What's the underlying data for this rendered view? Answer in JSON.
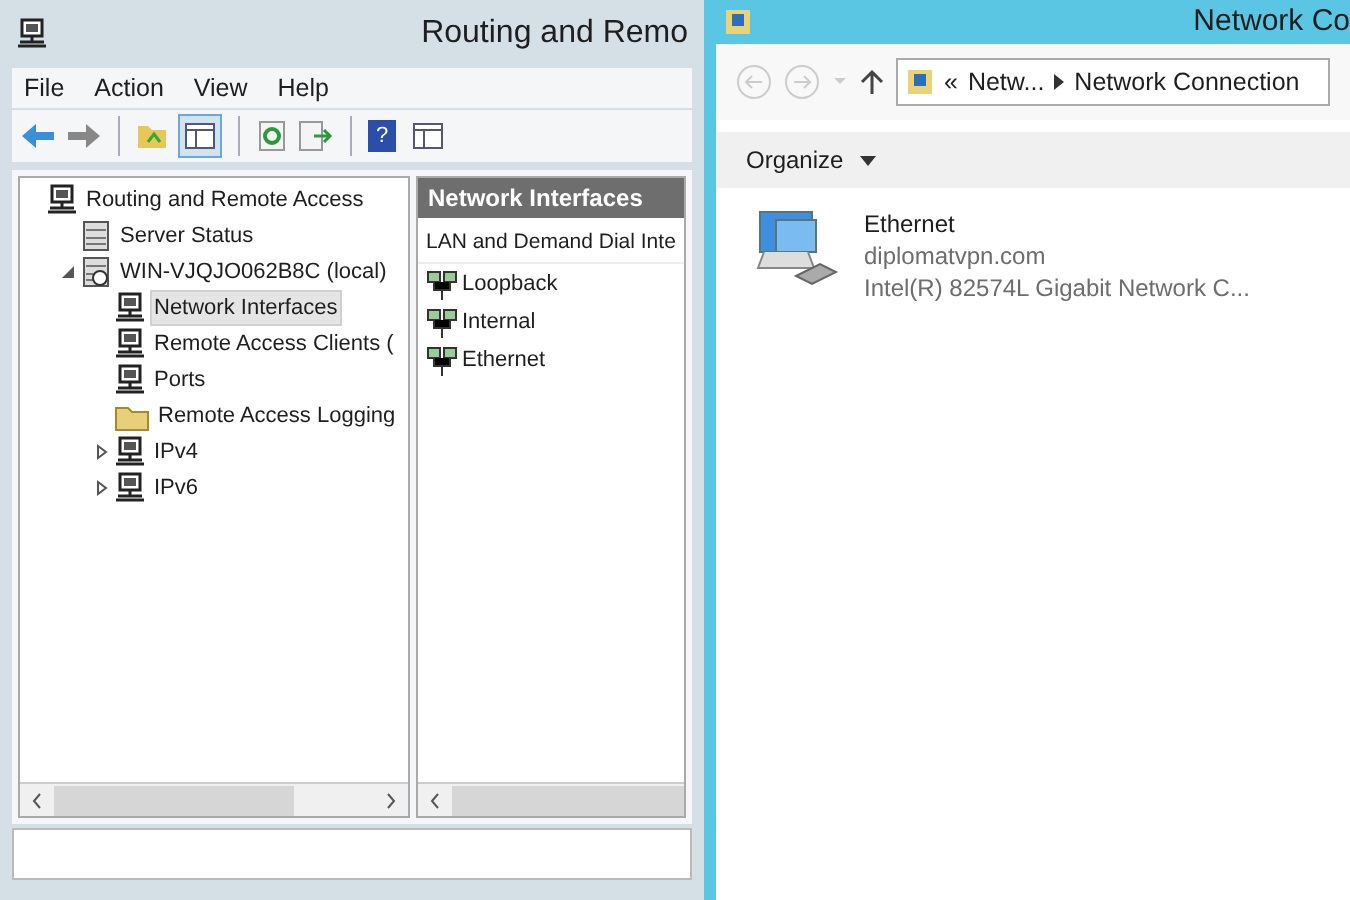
{
  "left_window": {
    "title": "Routing and Remo",
    "menu": [
      "File",
      "Action",
      "View",
      "Help"
    ],
    "toolbar": [
      {
        "kind": "back"
      },
      {
        "kind": "forward"
      },
      {
        "kind": "sep"
      },
      {
        "kind": "folder-up"
      },
      {
        "kind": "pane",
        "selected": true
      },
      {
        "kind": "sep"
      },
      {
        "kind": "refresh"
      },
      {
        "kind": "export"
      },
      {
        "kind": "sep"
      },
      {
        "kind": "help",
        "glyph": "?"
      },
      {
        "kind": "pane",
        "selected": false
      }
    ],
    "tree": [
      {
        "label": "Routing and Remote Access",
        "kind": "network",
        "selected": false,
        "children": [
          {
            "label": "Server Status",
            "kind": "server",
            "selected": false
          },
          {
            "label": "WIN-VJQJO062B8C (local)",
            "kind": "local",
            "expanded": true,
            "selected": false,
            "children": [
              {
                "label": "Network Interfaces",
                "kind": "network",
                "selected": true
              },
              {
                "label": "Remote Access Clients (",
                "kind": "network",
                "selected": false
              },
              {
                "label": "Ports",
                "kind": "network",
                "selected": false
              },
              {
                "label": "Remote Access Logging",
                "kind": "folder",
                "selected": false
              },
              {
                "label": "IPv4",
                "kind": "network",
                "expanded": false,
                "selected": false
              },
              {
                "label": "IPv6",
                "kind": "network",
                "expanded": false,
                "selected": false
              }
            ]
          }
        ]
      }
    ],
    "detail": {
      "header": "Network Interfaces",
      "column_1": "LAN and Demand Dial Inte",
      "rows": [
        "Loopback",
        "Internal",
        "Ethernet"
      ]
    }
  },
  "right_window": {
    "title": "Network Co",
    "breadcrumb_prefix": "«",
    "breadcrumb": [
      "Netw...",
      "Network Connection"
    ],
    "organize": "Organize",
    "items": [
      {
        "name": "Ethernet",
        "network": "diplomatvpn.com",
        "device": "Intel(R) 82574L Gigabit Network C..."
      }
    ]
  }
}
